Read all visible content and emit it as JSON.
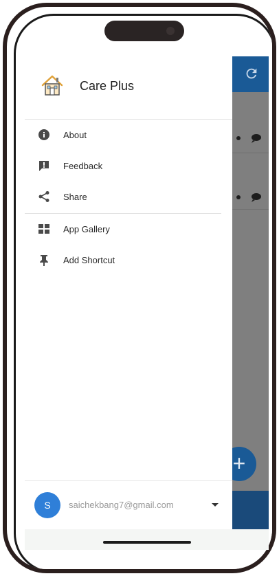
{
  "app": {
    "title": "Care Plus",
    "logo_icon": "house-icon"
  },
  "menu": {
    "items": [
      {
        "label": "About",
        "icon": "info-icon"
      },
      {
        "label": "Feedback",
        "icon": "feedback-icon"
      },
      {
        "label": "Share",
        "icon": "share-icon"
      },
      {
        "label": "App Gallery",
        "icon": "grid-icon"
      },
      {
        "label": "Add Shortcut",
        "icon": "pin-icon"
      }
    ]
  },
  "account": {
    "avatar_letter": "S",
    "email": "saichekbang7@gmail.com",
    "dropdown_icon": "caret-down-icon"
  },
  "background": {
    "refresh_icon": "refresh-icon",
    "fab_label": "+",
    "fab_icon": "add-icon"
  },
  "colors": {
    "appbar": "#1a5a96",
    "avatar": "#2f7fd8",
    "scrim": "#7f7f7f"
  }
}
